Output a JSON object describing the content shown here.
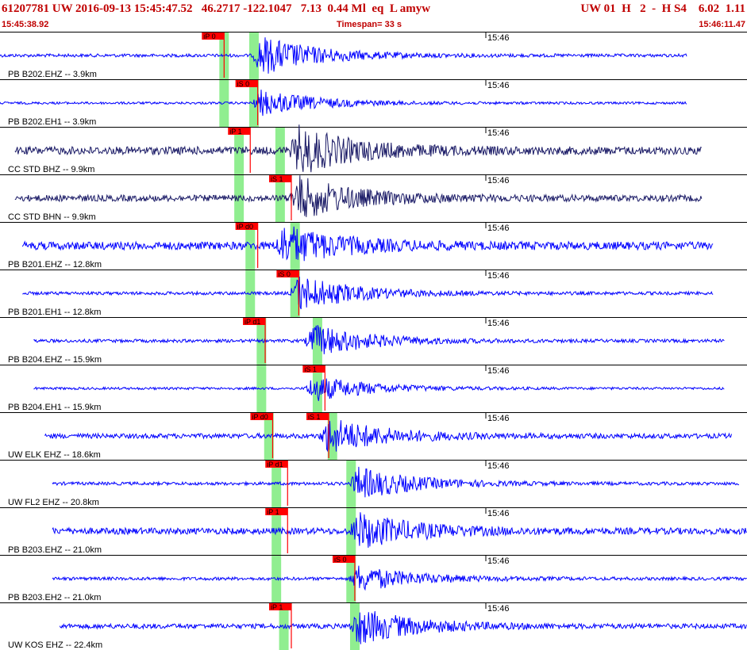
{
  "header": {
    "title": "61207781 UW 2016-09-13 15:45:47.52   46.2717 -122.1047   7.13  0.44 Ml  eq  L amyw",
    "title_right": "UW 01  H   2  -  H S4    6.02  1.11",
    "start_time": "15:45:38.92",
    "timespan": "Timespan=  33 s",
    "end_time": "15:46:11.47"
  },
  "colors": {
    "header_text": "#c00000",
    "trace_blue": "#0000ff",
    "trace_dark": "#1a1a66",
    "pick_red": "#ff0000",
    "window_green": "#90ee90"
  },
  "minute_label": "15:46",
  "traces": [
    {
      "label": "PB B202.EHZ -- 3.9km",
      "color": "#0000ff",
      "start": 0.0,
      "end": 0.92,
      "amp": 2,
      "burst": 0.35,
      "bamp": 24,
      "pick": {
        "text": "iP 0",
        "t": 0.3,
        "ptype": "P"
      },
      "windows": [
        0.3,
        0.34
      ]
    },
    {
      "label": "PB B202.EH1 -- 3.9km",
      "color": "#0000ff",
      "start": 0.0,
      "end": 0.92,
      "amp": 1.5,
      "burst": 0.35,
      "bamp": 16,
      "pick": {
        "text": "iS 0",
        "t": 0.345,
        "ptype": "S"
      },
      "windows": [
        0.3,
        0.34
      ]
    },
    {
      "label": "CC STD BHZ -- 9.9km",
      "color": "#1a1a66",
      "start": 0.02,
      "end": 0.94,
      "amp": 5,
      "burst": 0.4,
      "bamp": 28,
      "pick": {
        "text": "iP 1",
        "t": 0.335,
        "ptype": "P"
      },
      "windows": [
        0.32,
        0.375
      ]
    },
    {
      "label": "CC STD BHN -- 9.9km",
      "color": "#1a1a66",
      "start": 0.02,
      "end": 0.94,
      "amp": 4,
      "burst": 0.4,
      "bamp": 26,
      "pick": {
        "text": "iS 1",
        "t": 0.39,
        "ptype": "S"
      },
      "windows": [
        0.32,
        0.375
      ]
    },
    {
      "label": "PB B201.EHZ -- 12.8km",
      "color": "#0000ff",
      "start": 0.03,
      "end": 0.955,
      "amp": 5,
      "burst": 0.38,
      "bamp": 24,
      "pick": {
        "text": "iP d0",
        "t": 0.345,
        "ptype": "P"
      },
      "windows": [
        0.335,
        0.395
      ]
    },
    {
      "label": "PB B201.EH1 -- 12.8km",
      "color": "#0000ff",
      "start": 0.03,
      "end": 0.955,
      "amp": 2,
      "burst": 0.4,
      "bamp": 22,
      "pick": {
        "text": "iS 0",
        "t": 0.4,
        "ptype": "S"
      },
      "windows": [
        0.335,
        0.395
      ]
    },
    {
      "label": "PB B204.EHZ -- 15.9km",
      "color": "#0000ff",
      "start": 0.045,
      "end": 0.97,
      "amp": 2,
      "burst": 0.42,
      "bamp": 20,
      "pick": {
        "text": "iP d1",
        "t": 0.355,
        "ptype": "P"
      },
      "windows": [
        0.35,
        0.425
      ]
    },
    {
      "label": "PB B204.EH1 -- 15.9km",
      "color": "#0000ff",
      "start": 0.045,
      "end": 0.97,
      "amp": 1.5,
      "burst": 0.42,
      "bamp": 16,
      "pick": {
        "text": "iS 1",
        "t": 0.435,
        "ptype": "S"
      },
      "windows": [
        0.35,
        0.425
      ]
    },
    {
      "label": "UW ELK EHZ -- 18.6km",
      "color": "#0000ff",
      "start": 0.06,
      "end": 0.98,
      "amp": 3,
      "burst": 0.44,
      "bamp": 22,
      "pick": {
        "text": "iP d0",
        "t": 0.365,
        "ptype": "P"
      },
      "pick2": {
        "text": "iS 1",
        "t": 0.44,
        "ptype": "S"
      },
      "windows": [
        0.36,
        0.445
      ]
    },
    {
      "label": "UW FL2 EHZ -- 20.8km",
      "color": "#0000ff",
      "start": 0.07,
      "end": 0.99,
      "amp": 2,
      "burst": 0.48,
      "bamp": 20,
      "pick": {
        "text": "iP d1",
        "t": 0.385,
        "ptype": "P"
      },
      "windows": [
        0.37,
        0.47
      ]
    },
    {
      "label": "PB B203.EHZ -- 21.0km",
      "color": "#0000ff",
      "start": 0.07,
      "end": 1.0,
      "amp": 4,
      "burst": 0.48,
      "bamp": 22,
      "pick": {
        "text": "iP 1",
        "t": 0.385,
        "ptype": "P"
      },
      "windows": [
        0.37,
        0.47
      ]
    },
    {
      "label": "PB B203.EH2 -- 21.0km",
      "color": "#0000ff",
      "start": 0.07,
      "end": 1.0,
      "amp": 2,
      "burst": 0.48,
      "bamp": 16,
      "pick": {
        "text": "iS 0",
        "t": 0.475,
        "ptype": "S"
      },
      "windows": [
        0.37,
        0.47
      ]
    },
    {
      "label": "UW KOS EHZ -- 22.4km",
      "color": "#0000ff",
      "start": 0.08,
      "end": 1.0,
      "amp": 3,
      "burst": 0.48,
      "bamp": 22,
      "pick": {
        "text": "iP 1",
        "t": 0.39,
        "ptype": "P"
      },
      "windows": [
        0.38,
        0.475
      ]
    }
  ]
}
